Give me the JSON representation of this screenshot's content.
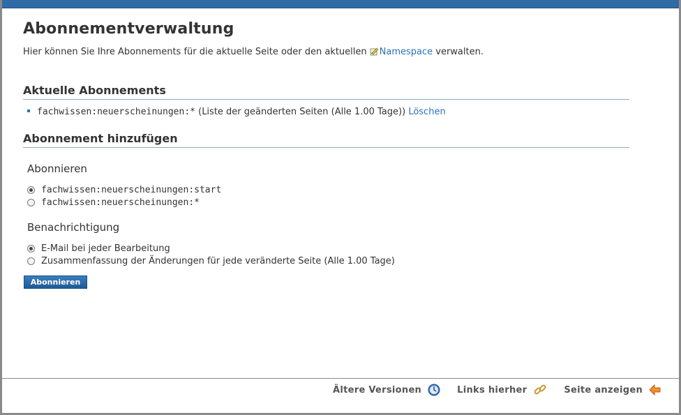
{
  "page": {
    "title": "Abonnementverwaltung",
    "intro_text": "Hier können Sie Ihre Abonnements für die aktuelle Seite oder den aktuellen",
    "intro_link": "Namespace",
    "intro_suffix": " verwalten."
  },
  "current": {
    "heading": "Aktuelle Abonnements",
    "items": [
      {
        "target": "fachwissen:neuerscheinungen:*",
        "description": " (Liste der geänderten Seiten (Alle 1.00 Tage))",
        "delete_label": "Löschen"
      }
    ]
  },
  "add": {
    "heading": "Abonnement hinzufügen",
    "subscribe_legend": "Abonnieren",
    "subscribe_options": [
      {
        "label": "fachwissen:neuerscheinungen:start",
        "checked": true
      },
      {
        "label": "fachwissen:neuerscheinungen:*",
        "checked": false
      }
    ],
    "notify_legend": "Benachrichtigung",
    "notify_options": [
      {
        "label": "E-Mail bei jeder Bearbeitung",
        "checked": true
      },
      {
        "label": "Zusammenfassung der Änderungen für jede veränderte Seite (Alle 1.00 Tage)",
        "checked": false
      }
    ],
    "submit_label": "Abonnieren"
  },
  "footer": {
    "revisions_label": "Ältere Versionen",
    "backlinks_label": "Links hierher",
    "show_label": "Seite anzeigen"
  },
  "icons": {
    "namespace": "namespace-icon",
    "revisions": "clock-icon",
    "backlinks": "chain-link-icon",
    "show": "back-arrow-icon"
  },
  "colors": {
    "accent": "#2d6aa6",
    "link": "#2b73b7",
    "button": "#1f5a95"
  }
}
